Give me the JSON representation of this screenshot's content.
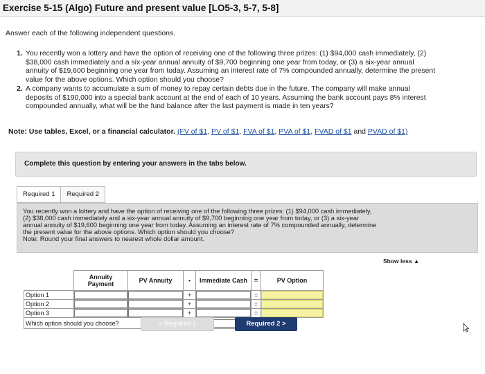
{
  "header": {
    "title": "Exercise 5-15 (Algo) Future and present value [LO5-3, 5-7, 5-8]"
  },
  "intro": "Answer each of the following independent questions.",
  "questions": [
    {
      "number": "1.",
      "lines": [
        "You recently won a lottery and have the option of receiving one of the following three prizes: (1) $94,000 cash immediately, (2)",
        "$38,000 cash immediately and a six-year annual annuity of $9,700 beginning one year from today, or (3) a six-year annual",
        "annuity of $19,600 beginning one year from today. Assuming an interest rate of 7% compounded annually, determine the present",
        "value for the above options. Which option should you choose?"
      ]
    },
    {
      "number": "2.",
      "lines": [
        "A company wants to accumulate a sum of money to repay certain debts due in the future. The company will make annual",
        "deposits of $190,000 into a special bank account at the end of each of 10 years. Assuming the bank account pays 8% interest",
        "compounded annually, what will be the fund balance after the last payment is made in ten years?"
      ]
    }
  ],
  "note": {
    "label": "Note: Use tables, Excel, or a financial calculator.",
    "links": [
      "(FV of $1",
      "PV of $1",
      "FVA of $1",
      "PVA of $1",
      "FVAD of $1",
      "PVAD of $1)"
    ],
    "sep": ", ",
    "and_text": " and "
  },
  "complete_banner": "Complete this question by entering your answers in the tabs below.",
  "tabs": [
    {
      "label": "Required 1"
    },
    {
      "label": "Required 2"
    }
  ],
  "panel": {
    "lines": [
      "You recently won a lottery and have the option of receiving one of the following three prizes: (1) $94,000 cash immediately,",
      "(2) $38,000 cash immediately and a six-year annual annuity of $9,700 beginning one year from today, or (3) a six-year",
      "annual annuity of $19,600 beginning one year from today. Assuming an interest rate of 7% compounded annually, determine",
      "the present value for the above options. Which option should you choose?",
      "Note: Round your final answers to nearest whole dollar amount."
    ]
  },
  "show_less": "Show less ▲",
  "table": {
    "headers": {
      "annuity_payment": "Annuity Payment",
      "pv_annuity": "PV Annuity",
      "op_mult": "•",
      "immediate_cash": "Immediate Cash",
      "op_eq": "=",
      "pv_option": "PV Option"
    },
    "rows": [
      {
        "label": "Option 1",
        "op_plus": "+",
        "op_eq": "=",
        "annuity_payment": "",
        "pv_annuity": "",
        "immediate_cash": "",
        "pv_option": ""
      },
      {
        "label": "Option 2",
        "op_plus": "+",
        "op_eq": "=",
        "annuity_payment": "",
        "pv_annuity": "",
        "immediate_cash": "",
        "pv_option": ""
      },
      {
        "label": "Option 3",
        "op_plus": "+",
        "op_eq": "=",
        "annuity_payment": "",
        "pv_annuity": "",
        "immediate_cash": "",
        "pv_option": ""
      }
    ],
    "choose_label": "Which option should you choose?",
    "choose_value": ""
  },
  "nav": {
    "prev_label": "<  Required 1",
    "next_label": "Required 2  >"
  },
  "icons": {
    "cursor": "mouse-pointer-icon"
  },
  "colors": {
    "title_bar": "#f3f3f3",
    "highlight_cells": "#f5f3a3",
    "next_button": "#1f3b70",
    "prev_button_disabled": "#dedede",
    "panel_bg": "#dcdcdc",
    "link": "#1a4fa0"
  }
}
